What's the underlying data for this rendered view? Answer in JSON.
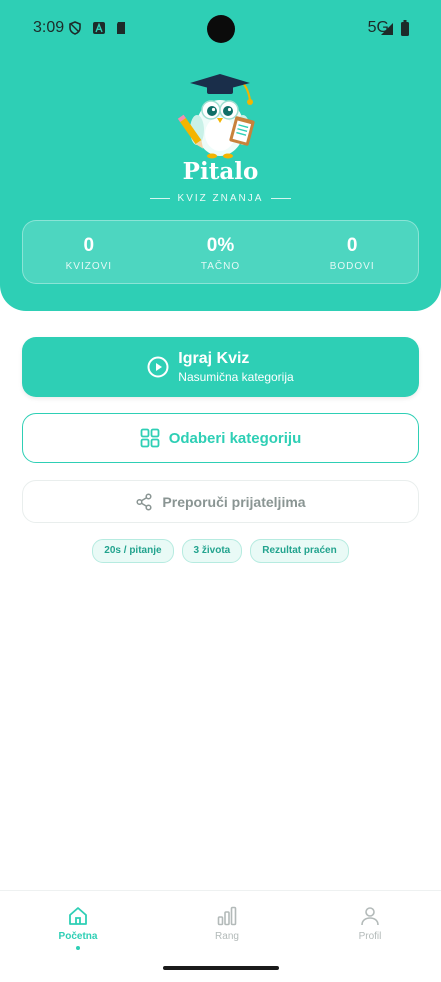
{
  "status_bar": {
    "time": "3:09",
    "network": "5G"
  },
  "header": {
    "app_name": "Pitalo",
    "subtitle": "KVIZ ZNANJA",
    "stats": [
      {
        "value": "0",
        "label": "KVIZOVI"
      },
      {
        "value": "0%",
        "label": "TAČNO"
      },
      {
        "value": "0",
        "label": "BODOVI"
      }
    ]
  },
  "actions": {
    "play": {
      "title": "Igraj Kviz",
      "subtitle": "Nasumična kategorija",
      "icon": "play-circle-icon"
    },
    "choose_category": {
      "label": "Odaberi kategoriju",
      "icon": "grid-icon"
    },
    "share": {
      "label": "Preporuči prijateljima",
      "icon": "share-icon"
    }
  },
  "chips": [
    "20s / pitanje",
    "3 života",
    "Rezultat praćen"
  ],
  "bottom_nav": {
    "items": [
      {
        "label": "Početna",
        "icon": "home-icon",
        "active": true
      },
      {
        "label": "Rang",
        "icon": "bar-chart-icon",
        "active": false
      },
      {
        "label": "Profil",
        "icon": "user-icon",
        "active": false
      }
    ]
  },
  "colors": {
    "accent": "#2ecfb5",
    "inactive": "#b3bab9",
    "chip_bg": "#e9faf6"
  }
}
